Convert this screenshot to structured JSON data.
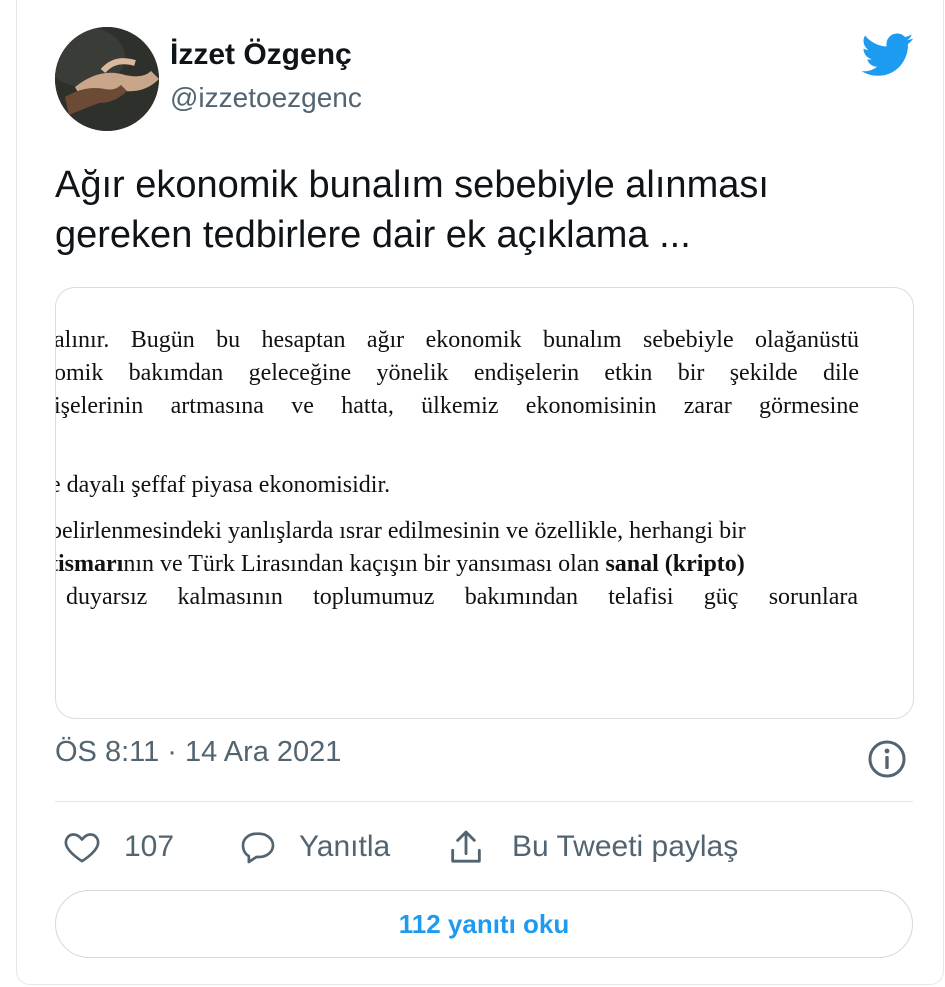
{
  "author": {
    "display_name": "İzzet Özgenç",
    "handle": "@izzetoezgenc"
  },
  "tweet": {
    "text_line1": "Ağır ekonomik bunalım sebebiyle alınması",
    "text_line2": "gereken tedbirlere dair ek açıklama ..."
  },
  "document": {
    "lines": [
      "alınır. Bugün bu hesaptan ağır ekonomik bunalım sebebiyle olağanüstü",
      "omik bakımdan geleceğine yönelik endişelerin etkin bir şekilde dile",
      "işelerinin artmasına ve hatta, ülkemiz ekonomisinin zarar görmesine",
      "e dayalı şeffaf piyasa ekonomisidir.",
      "belirlenmesindeki yanlışlarda ısrar edilmesinin ve özellikle, herhangi bir",
      "duyarsız kalmasının toplumumuz bakımından telafisi güç sorunlara"
    ],
    "line6": {
      "bold1": "tismarı",
      "normal": "nın ve Türk Lirasından kaçışın bir yansıması olan ",
      "bold2": "sanal (kripto)"
    }
  },
  "meta": {
    "timestamp": "ÖS 8:11 · 14 Ara 2021"
  },
  "actions": {
    "like_count": "107",
    "reply_label": "Yanıtla",
    "share_label": "Bu Tweeti paylaş"
  },
  "read_replies": "112 yanıtı oku",
  "colors": {
    "twitter_blue": "#1d9bf0",
    "secondary_text": "#536471",
    "primary_text": "#0f1419"
  },
  "icons": [
    "twitter-bird-icon",
    "info-icon",
    "heart-icon",
    "reply-bubble-icon",
    "share-icon"
  ]
}
